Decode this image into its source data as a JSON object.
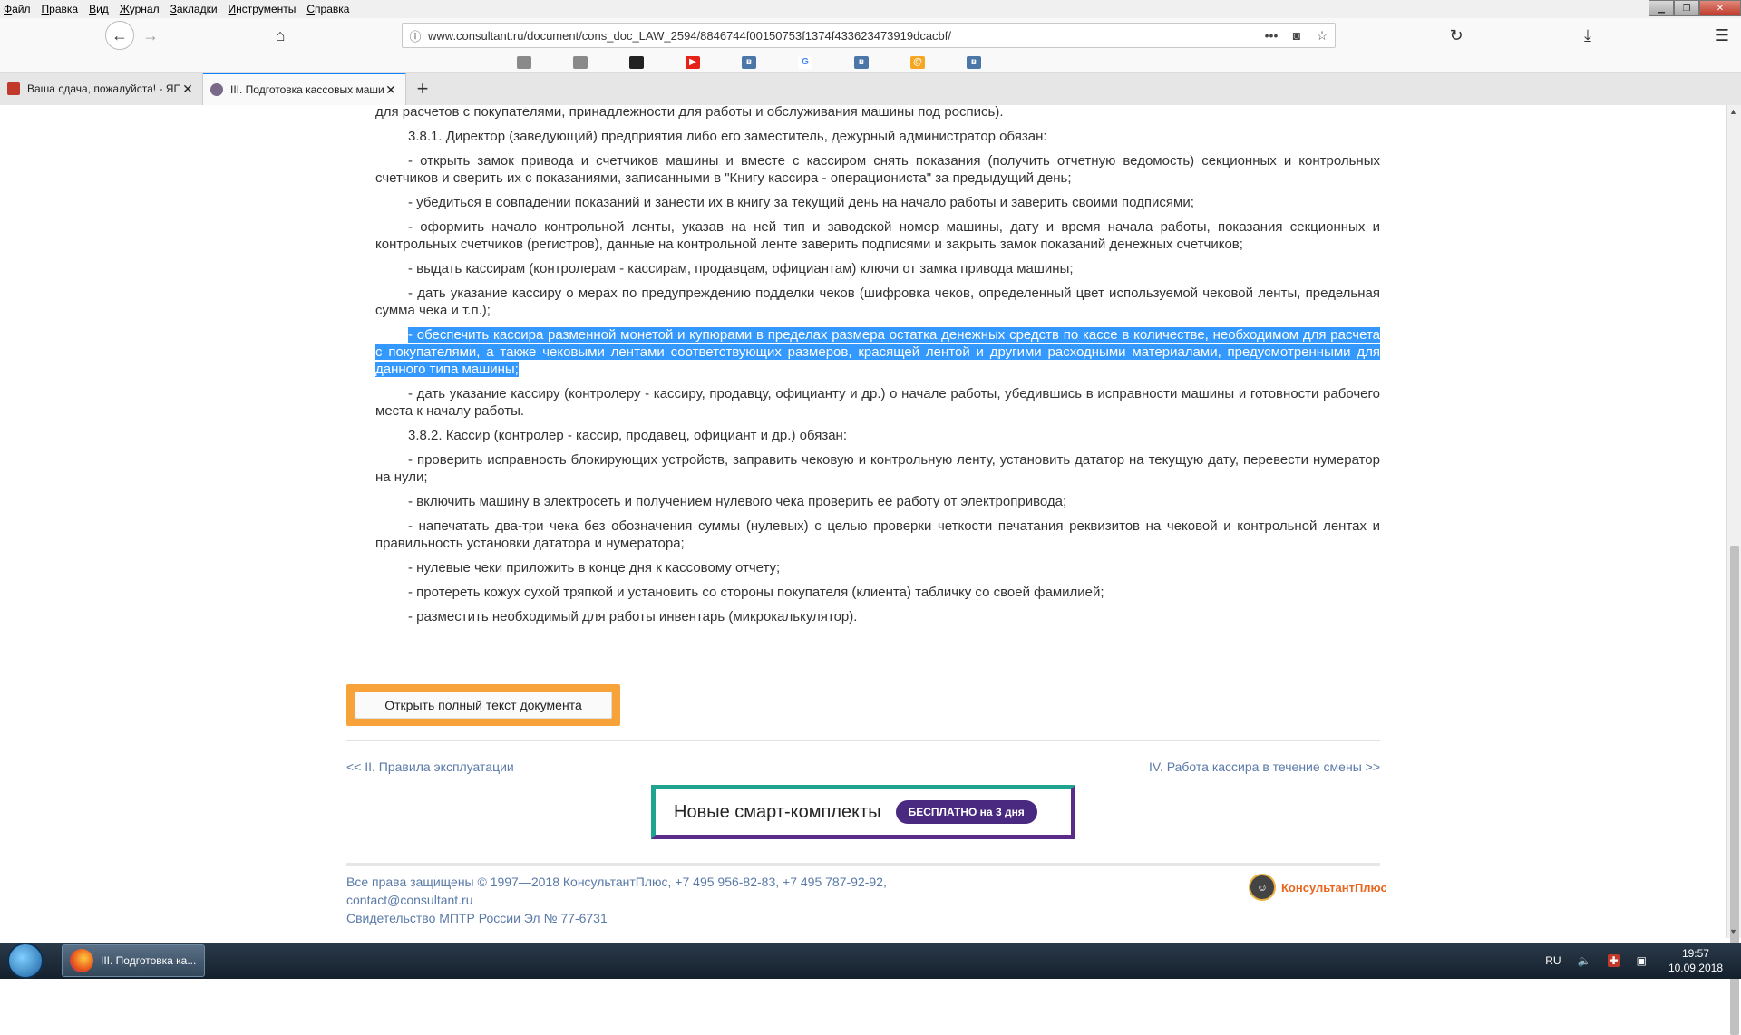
{
  "menu": [
    "Файл",
    "Правка",
    "Вид",
    "Журнал",
    "Закладки",
    "Инструменты",
    "Справка"
  ],
  "url": "www.consultant.ru/document/cons_doc_LAW_2594/8846744f00150753f1374f433623473919dcacbf/",
  "tabs": [
    {
      "label": "Ваша сдача, пожалуйста! - ЯПл",
      "active": false
    },
    {
      "label": "III. Подготовка кассовых маши",
      "active": true
    }
  ],
  "doc": {
    "p0": "для расчетов с покупателями, принадлежности для работы и обслуживания машины под роспись).",
    "p1": "3.8.1. Директор (заведующий) предприятия либо его заместитель, дежурный администратор обязан:",
    "p2": "- открыть замок привода и счетчиков машины и вместе с кассиром снять показания (получить отчетную ведомость) секционных и контрольных счетчиков и сверить их с показаниями, записанными в \"Книгу кассира - операциониста\" за предыдущий день;",
    "p3": "- убедиться в совпадении показаний и занести их в книгу за текущий день на начало работы и заверить своими подписями;",
    "p4": "- оформить начало контрольной ленты, указав на ней тип и заводской номер машины, дату и время начала работы, показания секционных и контрольных счетчиков (регистров), данные на контрольной ленте заверить подписями и закрыть замок показаний денежных счетчиков;",
    "p5": "- выдать кассирам (контролерам - кассирам, продавцам, официантам) ключи от замка привода машины;",
    "p6": "- дать указание кассиру о мерах по предупреждению подделки чеков (шифровка чеков, определенный цвет используемой чековой ленты, предельная сумма чека и т.п.);",
    "p7": "- обеспечить кассира разменной монетой и купюрами в пределах размера остатка денежных средств по кассе в количестве, необходимом для расчета с покупателями, а также чековыми лентами соответствующих размеров, красящей лентой и другими расходными материалами, предусмотренными для данного типа машины;",
    "p8": "- дать указание кассиру (контролеру - кассиру, продавцу, официанту и др.) о начале работы, убедившись в исправности машины и готовности рабочего места к началу работы.",
    "p9": "3.8.2. Кассир (контролер - кассир, продавец, официант и др.) обязан:",
    "p10": "- проверить исправность блокирующих устройств, заправить чековую и контрольную ленту, установить дататор на текущую дату, перевести нумератор на нули;",
    "p11": "- включить машину в электросеть и получением нулевого чека проверить ее работу от электропривода;",
    "p12": "- напечатать два-три чека без обозначения суммы (нулевых) с целью проверки четкости печатания реквизитов на чековой и контрольной лентах и правильность установки дататора и нумератора;",
    "p13": "- нулевые чеки приложить в конце дня к кассовому отчету;",
    "p14": "- протереть кожух сухой тряпкой и установить со стороны покупателя (клиента) табличку со своей фамилией;",
    "p15": "- разместить необходимый для работы инвентарь (микрокалькулятор)."
  },
  "open_button": "Открыть полный текст документа",
  "prev_link": "<< II. Правила эксплуатации",
  "next_link": "IV. Работа кассира в течение смены >>",
  "banner": {
    "text": "Новые смарт-комплекты",
    "pill": "БЕСПЛАТНО на 3 дня"
  },
  "footer": {
    "line1": "Все права защищены © 1997—2018 КонсультантПлюс, +7 495 956-82-83, +7 495 787-92-92,",
    "line2": "contact@consultant.ru",
    "line3": "Свидетельство МПТР России Эл № 77-6731",
    "logo": "КонсультантПлюс"
  },
  "taskbar": {
    "item": "III. Подготовка ка...",
    "lang": "RU",
    "time": "19:57",
    "date": "10.09.2018"
  },
  "colors": {
    "highlight": "#3399ff",
    "button_frame": "#f8a33a",
    "link": "#5a7aa8"
  }
}
